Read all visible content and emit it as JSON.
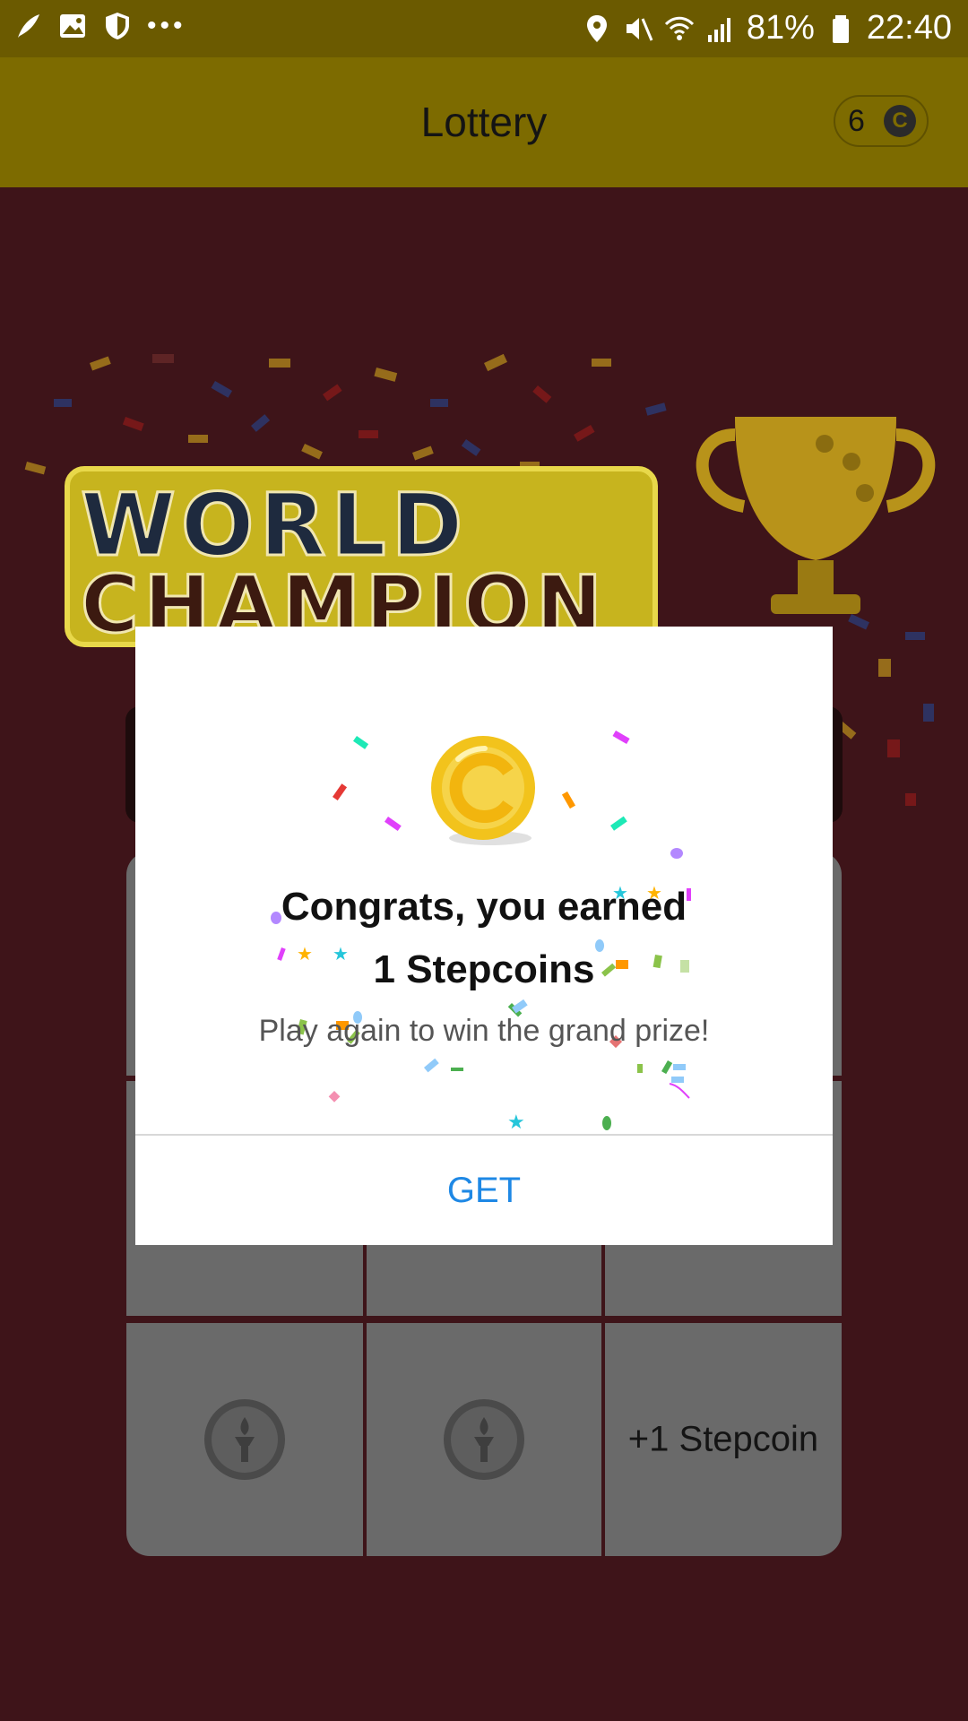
{
  "status_bar": {
    "left_icons": [
      "feather-icon",
      "image-icon",
      "shield-icon",
      "more-dots-icon"
    ],
    "battery": "81%",
    "time": "22:40",
    "right_icons": [
      "location-icon",
      "mute-icon",
      "wifi-icon",
      "signal-icon",
      "battery-icon"
    ]
  },
  "app_bar": {
    "title": "Lottery",
    "coin_count": "6",
    "coin_symbol": "C"
  },
  "banner": {
    "line1": "WORLD",
    "line2": "CHAMPION"
  },
  "grid": {
    "cells": [
      {
        "type": "torch"
      },
      {
        "type": "torch"
      },
      {
        "type": "text",
        "label": "+1 Stepcoin"
      }
    ]
  },
  "dialog": {
    "coin_symbol": "C",
    "title_line1": "Congrats, you earned",
    "title_line2": "1 Stepcoins",
    "subtitle": "Play again to win the grand prize!",
    "button": "GET"
  },
  "colors": {
    "status_bar": "#6b5a00",
    "app_bar": "#7d6b00",
    "background": "#3e1419",
    "accent_button": "#1e88e5",
    "coin_gold": "#f2c31c"
  }
}
